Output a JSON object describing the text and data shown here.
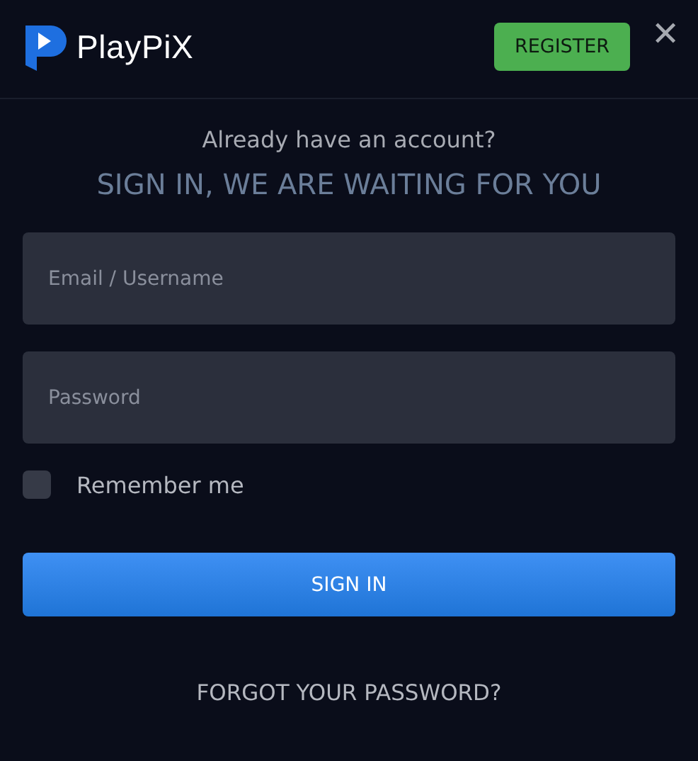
{
  "header": {
    "logo_text": "PlayPiX",
    "register_button": "REGISTER",
    "close_button": "✕"
  },
  "intro": {
    "question": "Already have an account?",
    "title": "SIGN IN, WE ARE WAITING FOR YOU"
  },
  "fields": [
    {
      "placeholder": "Email / Username"
    },
    {
      "placeholder": "Password"
    }
  ],
  "remember": {
    "label": "Remember me",
    "checked": false
  },
  "submit_button": "SIGN IN",
  "forgot_link": "FORGOT YOUR PASSWORD?"
}
